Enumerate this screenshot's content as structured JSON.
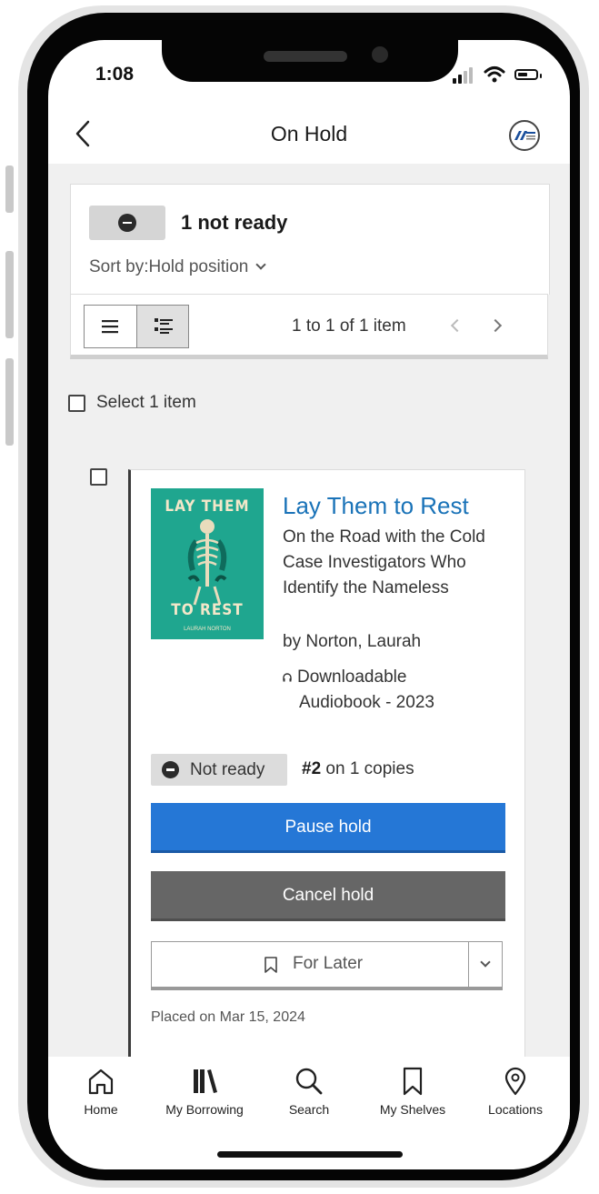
{
  "status_bar": {
    "time": "1:08"
  },
  "header": {
    "back_label": "Back",
    "title": "On Hold"
  },
  "summary": {
    "not_ready_count": "1 not ready",
    "sort_label": "Sort by:",
    "sort_value": "Hold position"
  },
  "toolbar": {
    "paging_text": "1 to 1 of 1 item"
  },
  "selection": {
    "select_all_label": "Select 1 item"
  },
  "item": {
    "title": "Lay Them to Rest",
    "subtitle": "On the Road with the Cold Case Investigators Who Identify the Nameless",
    "author": "by Norton, Laurah",
    "format_line1": "Downloadable",
    "format_line2": "Audiobook - 2023",
    "cover": {
      "line1": "LAY THEM",
      "line2": "TO REST",
      "author": "LAURAH NORTON"
    },
    "status": "Not ready",
    "queue_position": "#2",
    "queue_rest": " on 1 copies",
    "pause_label": "Pause hold",
    "cancel_label": "Cancel hold",
    "shelf_label": "For Later",
    "placed_on": "Placed on Mar 15, 2024"
  },
  "bottom_nav": [
    {
      "label": "Home",
      "icon": "home-icon"
    },
    {
      "label": "My Borrowing",
      "icon": "books-icon"
    },
    {
      "label": "Search",
      "icon": "search-icon"
    },
    {
      "label": "My Shelves",
      "icon": "bookmark-icon"
    },
    {
      "label": "Locations",
      "icon": "location-pin-icon"
    }
  ],
  "colors": {
    "link_blue": "#1a73b8",
    "primary_button": "#2577d6",
    "secondary_button": "#666666",
    "cover_teal": "#1fa68f"
  }
}
